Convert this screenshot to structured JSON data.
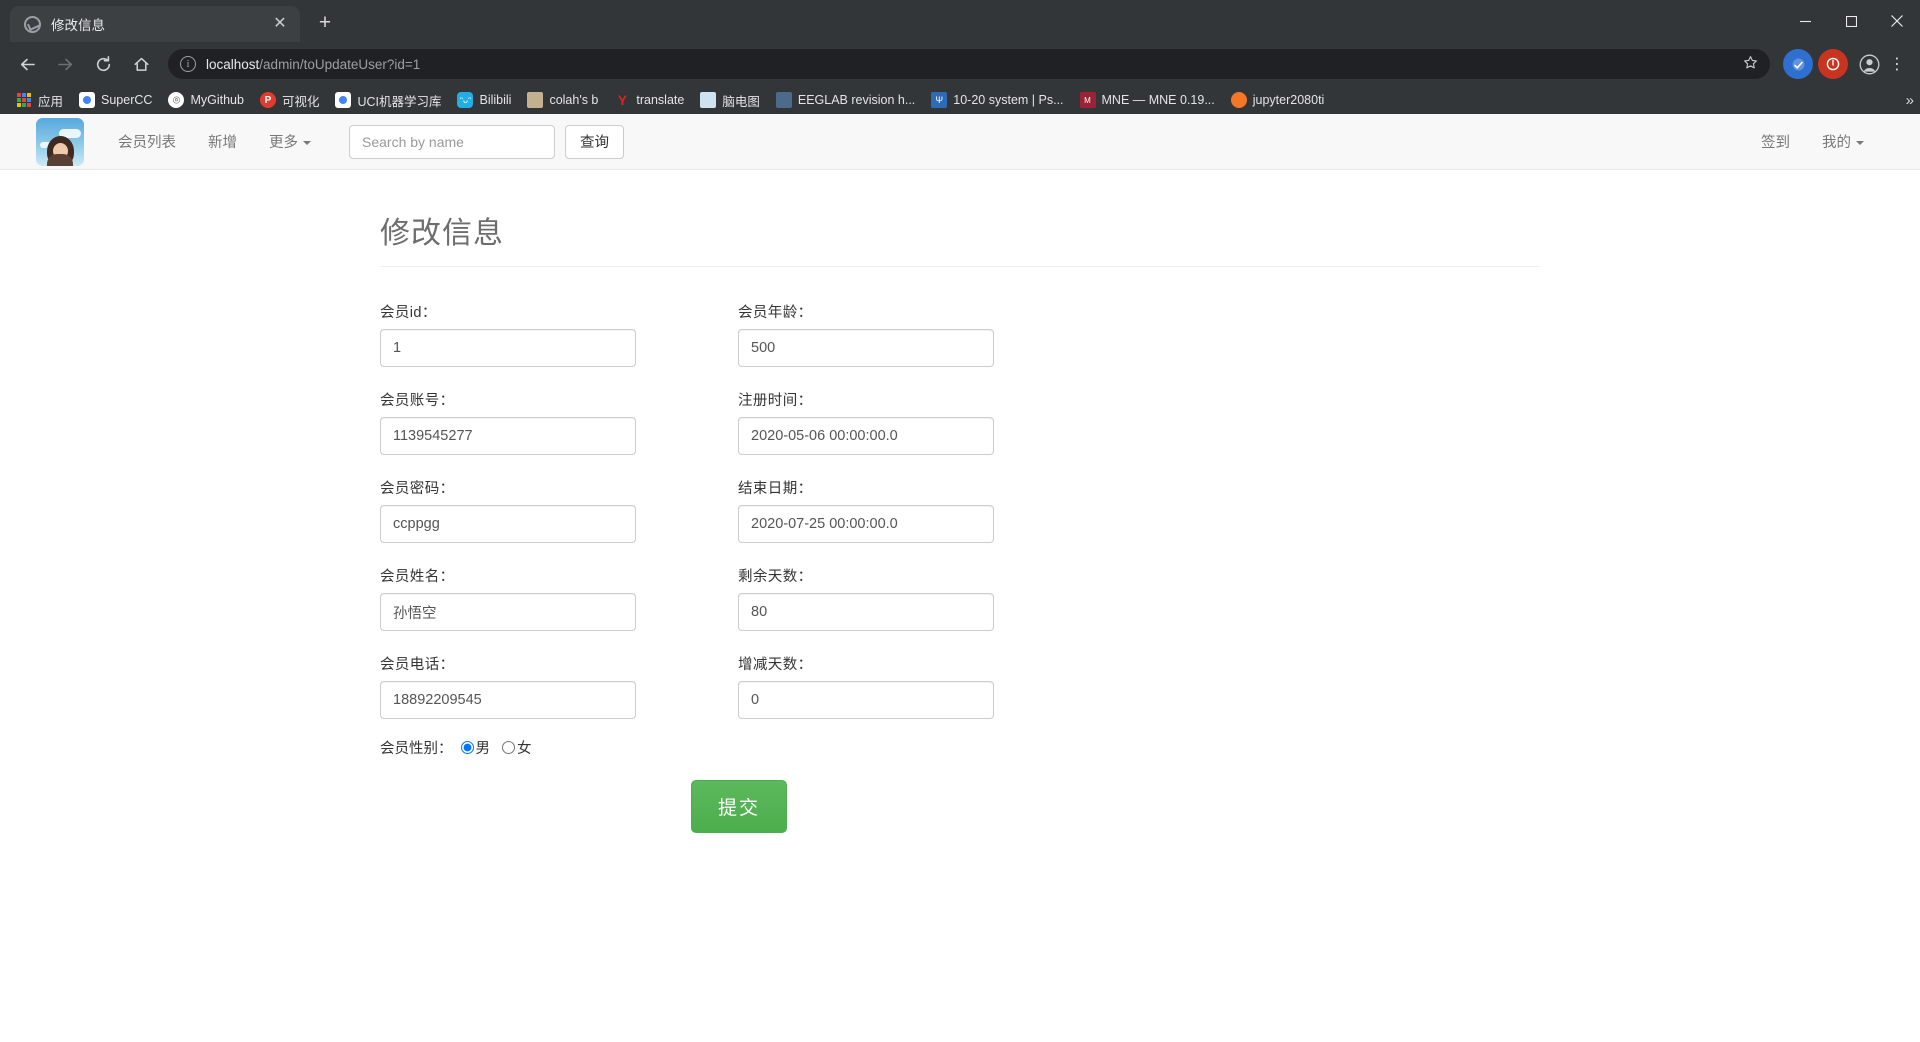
{
  "browser": {
    "tab": {
      "title": "修改信息",
      "favicon": "globe-icon",
      "close": "✕"
    },
    "newtab_label": "+",
    "window_controls": {
      "minimize": "minimize-icon",
      "maximize": "maximize-icon",
      "close": "close-icon"
    },
    "toolbar": {
      "back": "back-arrow-icon",
      "forward": "forward-arrow-icon",
      "reload": "reload-icon",
      "home": "home-icon",
      "url_host": "localhost",
      "url_path": "/admin/toUpdateUser?id=1",
      "url_full": "localhost/admin/toUpdateUser?id=1",
      "star": "★",
      "ext1": "extension-blue-icon",
      "ext2": "extension-red-icon",
      "profile": "profile-avatar-icon",
      "menu": "⋮"
    },
    "bookmarks": [
      {
        "label": "应用",
        "icon": "apps-grid-icon",
        "color": "#4a90d9"
      },
      {
        "label": "SuperCC",
        "icon": "chrome-icon",
        "color": "#ffffff"
      },
      {
        "label": "MyGithub",
        "icon": "github-icon",
        "color": "#ffffff"
      },
      {
        "label": "可视化",
        "icon": "p-icon",
        "color": "#e23b2e"
      },
      {
        "label": "UCI机器学习库",
        "icon": "chrome-icon",
        "color": "#ffffff"
      },
      {
        "label": "Bilibili",
        "icon": "bilibili-icon",
        "color": "#23ade5"
      },
      {
        "label": "colah's b",
        "icon": "page-icon",
        "color": "#c3b091"
      },
      {
        "label": "translate",
        "icon": "y-icon",
        "color": "#e02020"
      },
      {
        "label": "脑电图",
        "icon": "brain-icon",
        "color": "#8fb7d8"
      },
      {
        "label": "EEGLAB revision h...",
        "icon": "page-icon",
        "color": "#4c6b8a"
      },
      {
        "label": "10-20 system | Ps...",
        "icon": "psy-icon",
        "color": "#2d6cb5"
      },
      {
        "label": "MNE — MNE 0.19...",
        "icon": "mne-icon",
        "color": "#9b2335"
      },
      {
        "label": "jupyter2080ti",
        "icon": "jupyter-icon",
        "color": "#f37726"
      }
    ],
    "bookmarks_overflow": "»"
  },
  "site_nav": {
    "logo": "site-avatar-logo",
    "links": [
      {
        "label": "会员列表",
        "has_caret": false
      },
      {
        "label": "新增",
        "has_caret": false
      },
      {
        "label": "更多",
        "has_caret": true
      }
    ],
    "search": {
      "placeholder": "Search by name",
      "value": ""
    },
    "search_button": "查询",
    "right_links": [
      {
        "label": "签到",
        "has_caret": false
      },
      {
        "label": "我的",
        "has_caret": true
      }
    ]
  },
  "main": {
    "title": "修改信息",
    "fields_left": [
      {
        "label": "会员id：",
        "value": "1",
        "name": "member-id"
      },
      {
        "label": "会员账号：",
        "value": "1139545277",
        "name": "member-account"
      },
      {
        "label": "会员密码：",
        "value": "ccppgg",
        "name": "member-password"
      },
      {
        "label": "会员姓名：",
        "value": "孙悟空",
        "name": "member-name"
      },
      {
        "label": "会员电话：",
        "value": "18892209545",
        "name": "member-phone"
      }
    ],
    "fields_right": [
      {
        "label": "会员年龄：",
        "value": "500",
        "name": "member-age"
      },
      {
        "label": "注册时间：",
        "value": "2020-05-06 00:00:00.0",
        "name": "register-time"
      },
      {
        "label": "结束日期：",
        "value": "2020-07-25 00:00:00.0",
        "name": "end-date"
      },
      {
        "label": "剩余天数：",
        "value": "80",
        "name": "remaining-days"
      },
      {
        "label": "增减天数：",
        "value": "0",
        "name": "adjust-days"
      }
    ],
    "gender": {
      "label": "会员性别：",
      "options": [
        {
          "label": "男",
          "checked": true
        },
        {
          "label": "女",
          "checked": false
        }
      ]
    },
    "submit_label": "提交"
  },
  "colors": {
    "submit_green": "#4cae4c",
    "navbar_bg": "#f8f8f8",
    "chrome_bg": "#323639"
  }
}
